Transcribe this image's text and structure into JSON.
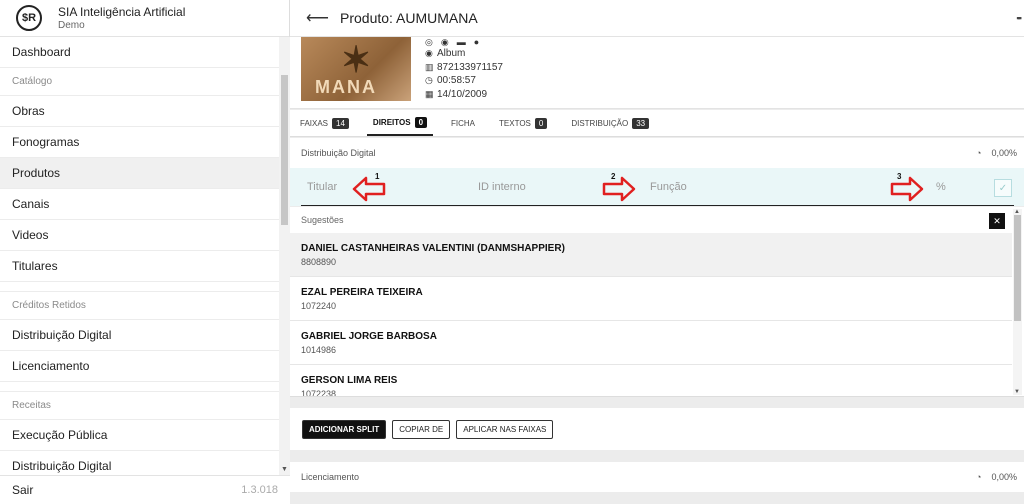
{
  "app": {
    "name": "SIA Inteligência Artificial",
    "subtitle": "Demo",
    "logo_text": "$R",
    "version": "1.3.018",
    "exit_label": "Sair"
  },
  "sidebar": {
    "dashboard": "Dashboard",
    "sec_catalogo": "Catálogo",
    "obras": "Obras",
    "fonogramas": "Fonogramas",
    "produtos": "Produtos",
    "canais": "Canais",
    "videos": "Videos",
    "titulares": "Titulares",
    "sec_creditos": "Créditos Retidos",
    "distribuicao_digital": "Distribuição Digital",
    "licenciamento": "Licenciamento",
    "sec_receitas": "Receitas",
    "execucao_publica": "Execução Pública",
    "distribuicao_digital_2": "Distribuição Digital"
  },
  "header": {
    "title": "Produto: AUMUMANA"
  },
  "product": {
    "cover_text": "MANA",
    "type": "Album",
    "barcode": "872133971157",
    "duration": "00:58:57",
    "date": "14/10/2009"
  },
  "tabs": [
    {
      "label": "FAIXAS",
      "count": "14"
    },
    {
      "label": "DIREITOS",
      "count": "0"
    },
    {
      "label": "FICHA",
      "count": ""
    },
    {
      "label": "TEXTOS",
      "count": "0"
    },
    {
      "label": "DISTRIBUIÇÃO",
      "count": "33"
    }
  ],
  "distribution": {
    "title": "Distribuição Digital",
    "percent": "0,00%"
  },
  "form": {
    "titular_placeholder": "Titular",
    "id_placeholder": "ID interno",
    "funcao_placeholder": "Função",
    "percent_placeholder": "%",
    "marker_1": "1",
    "marker_2": "2",
    "marker_3": "3"
  },
  "suggestions": {
    "title": "Sugestões",
    "items": [
      {
        "name": "DANIEL CASTANHEIRAS VALENTINI (DANMSHAPPIER)",
        "code": "8808890"
      },
      {
        "name": "EZAL PEREIRA TEIXEIRA",
        "code": "1072240"
      },
      {
        "name": "GABRIEL JORGE BARBOSA",
        "code": "1014986"
      },
      {
        "name": "GERSON LIMA REIS",
        "code": "1072238"
      }
    ]
  },
  "actions": {
    "add_split": "ADICIONAR SPLIT",
    "copy_from": "COPIAR DE",
    "apply_tracks": "APLICAR NAS FAIXAS"
  },
  "licensing": {
    "title": "Licenciamento",
    "percent": "0,00%"
  },
  "colors": {
    "accent": "#111111",
    "arrow": "#e02020",
    "input_bg": "#eaf7f8"
  }
}
